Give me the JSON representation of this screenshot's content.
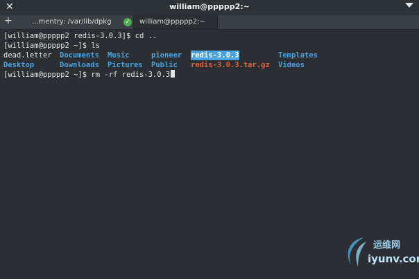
{
  "window": {
    "title": "william@ppppp2:~",
    "close_glyph": "✕"
  },
  "tabs": [
    {
      "label": "...mentry: /var/lib/dpkg",
      "status_icon": "check-circle-icon"
    },
    {
      "label": "william@ppppp2:~"
    }
  ],
  "terminal": {
    "line1": "[william@ppppp2 redis-3.0.3]$ cd ..",
    "line2": "[william@ppppp2 ~]$ ls",
    "ls_row1": [
      "dead.letter",
      "Documents",
      "Music",
      "pioneer",
      "redis-3.0.3",
      "Templates"
    ],
    "ls_row2": [
      "Desktop",
      "Downloads",
      "Pictures",
      "Public",
      "redis-3.0.3.tar.gz",
      "Videos"
    ],
    "line3": "[william@ppppp2 ~]$ rm -rf redis-3.0.3"
  },
  "watermark": {
    "text1": "运维网",
    "text2": "iyunv.com"
  },
  "colors": {
    "background": "#2b2f33",
    "directory": "#4aa3df",
    "archive": "#e0603a",
    "text": "#e4e4e4"
  }
}
